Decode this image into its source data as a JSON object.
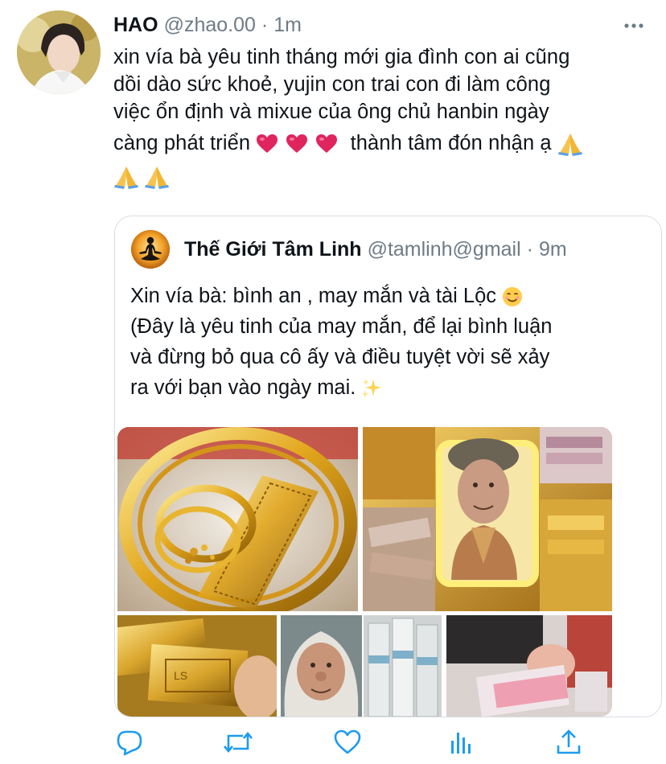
{
  "tweet": {
    "author_name": "HAO",
    "handle": "@zhao.00",
    "separator": "·",
    "time": "1m",
    "text_lines": [
      "xin vía bà yêu tinh tháng mới gia đình con ai cũng",
      "dồi dào sức khoẻ, yujin con trai con đi làm công",
      "việc ổn định và mixue của ông chủ hanbin ngày"
    ],
    "text_line4_before": "càng phát triển ",
    "text_line4_after": " thành tâm đón nhận ạ "
  },
  "quote": {
    "author_name": "Thế Giới Tâm Linh",
    "handle": "@tamlinh@gmail",
    "separator": "·",
    "time": "9m",
    "text_line1": "Xin vía bà: bình an , may mắn và tài Lộc ",
    "text_lines": [
      "(Đây là yêu tinh của may mắn, để lại bình luận",
      "và đừng bỏ qua cô ấy và điều tuyệt vời sẽ xảy"
    ],
    "text_line4": "ra với bạn vào ngày mai. "
  },
  "media": [
    {
      "name": "gold-bracelets-image"
    },
    {
      "name": "old-woman-gold-collage-image"
    },
    {
      "name": "gold-bars-image"
    },
    {
      "name": "old-woman-portrait-image"
    },
    {
      "name": "money-bundles-image"
    },
    {
      "name": "hands-cash-image"
    }
  ],
  "actions": [
    "reply-icon",
    "retweet-icon",
    "like-icon",
    "analytics-icon",
    "share-icon"
  ],
  "colors": {
    "text": "#0f1419",
    "secondary": "#6e7b86",
    "icon": "#1d9bf0",
    "border": "#d6dde3",
    "heart": "#e0245e"
  }
}
